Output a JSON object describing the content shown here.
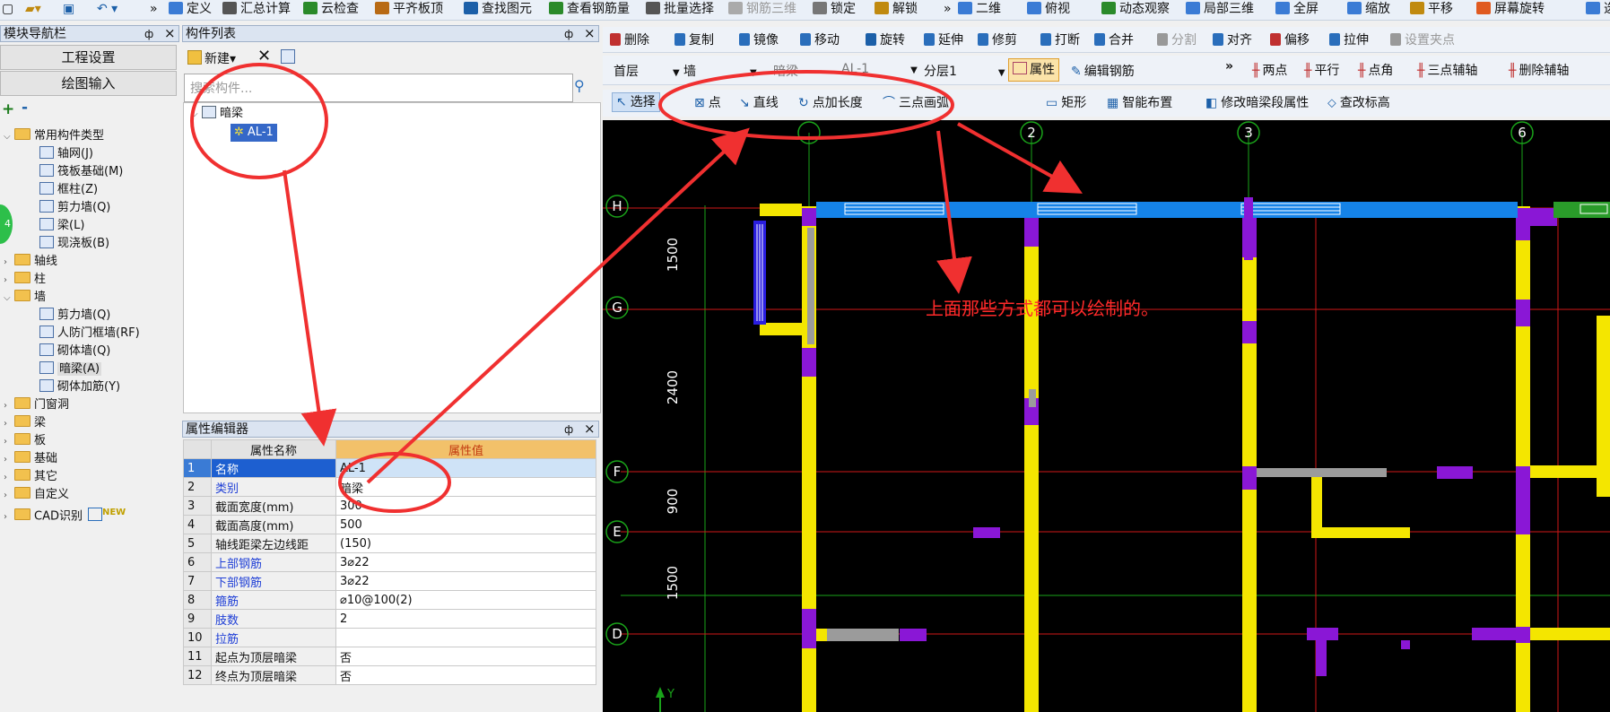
{
  "top_toolbar": {
    "items": [
      "定义",
      "汇总计算",
      "云检查",
      "平齐板顶",
      "查找图元",
      "查看钢筋量",
      "批量选择",
      "钢筋三维",
      "锁定",
      "解锁",
      "二维",
      "俯视",
      "动态观察",
      "局部三维",
      "全屏",
      "缩放",
      "平移",
      "屏幕旋转",
      "选"
    ],
    "more": "»"
  },
  "nav": {
    "title": "模块导航栏",
    "pin": "ф",
    "close": "×",
    "btn_project": "工程设置",
    "btn_draw": "绘图输入",
    "expand": "+",
    "collapse": "-",
    "tree": {
      "common": "常用构件类型",
      "common_items": [
        "轴网(J)",
        "筏板基础(M)",
        "框柱(Z)",
        "剪力墙(Q)",
        "梁(L)",
        "现浇板(B)"
      ],
      "axis": "轴线",
      "column": "柱",
      "wall": "墙",
      "wall_items": [
        "剪力墙(Q)",
        "人防门框墙(RF)",
        "砌体墙(Q)",
        "暗梁(A)",
        "砌体加筋(Y)"
      ],
      "others": [
        "门窗洞",
        "梁",
        "板",
        "基础",
        "其它",
        "自定义",
        "CAD识别"
      ],
      "new_badge": "NEW"
    },
    "side_badge": "4"
  },
  "comp": {
    "title": "构件列表",
    "pin": "ф",
    "close": "×",
    "new": "新建",
    "search_placeholder": "搜索构件...",
    "group": "暗梁",
    "item": "AL-1"
  },
  "props": {
    "title": "属性编辑器",
    "pin": "ф",
    "close": "×",
    "col_name": "属性名称",
    "col_value": "属性值",
    "rows": [
      {
        "n": "1",
        "name": "名称",
        "value": "AL-1",
        "blue": false
      },
      {
        "n": "2",
        "name": "类别",
        "value": "暗梁",
        "blue": true
      },
      {
        "n": "3",
        "name": "截面宽度(mm)",
        "value": "300",
        "blue": false
      },
      {
        "n": "4",
        "name": "截面高度(mm)",
        "value": "500",
        "blue": false
      },
      {
        "n": "5",
        "name": "轴线距梁左边线距",
        "value": "(150)",
        "blue": false
      },
      {
        "n": "6",
        "name": "上部钢筋",
        "value": "3⌀22",
        "blue": true
      },
      {
        "n": "7",
        "name": "下部钢筋",
        "value": "3⌀22",
        "blue": true
      },
      {
        "n": "8",
        "name": "箍筋",
        "value": "⌀10@100(2)",
        "blue": true
      },
      {
        "n": "9",
        "name": "肢数",
        "value": "2",
        "blue": true
      },
      {
        "n": "10",
        "name": "拉筋",
        "value": "",
        "blue": true
      },
      {
        "n": "11",
        "name": "起点为顶层暗梁",
        "value": "否",
        "blue": false
      },
      {
        "n": "12",
        "name": "终点为顶层暗梁",
        "value": "否",
        "blue": false
      }
    ]
  },
  "edit_toolbar": {
    "items": [
      "删除",
      "复制",
      "镜像",
      "移动",
      "旋转",
      "延伸",
      "修剪",
      "打断",
      "合并",
      "分割",
      "对齐",
      "偏移",
      "拉伸",
      "设置夹点"
    ]
  },
  "layer_bar": {
    "floor": "首层",
    "type": "墙",
    "comp_type": "暗梁",
    "comp": "AL-1",
    "layer": "分层1",
    "properties": "属性",
    "edit_rebar": "编辑钢筋",
    "more": "»",
    "right_items": [
      "两点",
      "平行",
      "点角",
      "三点辅轴",
      "删除辅轴"
    ]
  },
  "draw_bar": {
    "items": [
      "选择",
      "点",
      "直线",
      "点加长度",
      "三点画弧",
      "矩形",
      "智能布置",
      "修改暗梁段属性",
      "查改标高"
    ]
  },
  "cad": {
    "col_labels": [
      "2",
      "3",
      "6"
    ],
    "row_labels": [
      "H",
      "G",
      "F",
      "E",
      "D"
    ],
    "dims": [
      "1500",
      "2400",
      "900",
      "1500"
    ],
    "annotation": "上面那些方式都可以绘制的。",
    "y_axis": "Y"
  },
  "colors": {
    "accent": "#3a7bd5",
    "annotation": "#ff2a2a",
    "wall": "#f4e600",
    "beam": "#1583e8",
    "column": "#8a17d6"
  }
}
